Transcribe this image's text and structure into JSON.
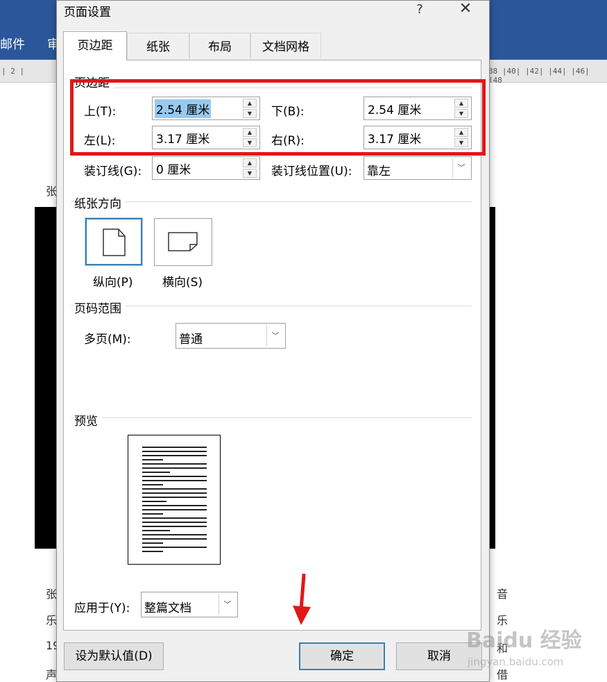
{
  "background": {
    "ribbon_tabs": [
      "邮件",
      "审"
    ],
    "ruler_left": "| 2 | ",
    "ruler_right": "38  |40|  |42|  |44|  |46|  |48",
    "doc_chars_left": [
      "张",
      "张",
      "乐",
      "19",
      "声"
    ],
    "doc_chars_right": [
      "音",
      "乐",
      "和",
      "借"
    ],
    "colors": {
      "ribbon": "#2b579a",
      "doc_image": "#000000"
    }
  },
  "dialog": {
    "title": "页面设置",
    "help_label": "?",
    "close_label": "✕",
    "tabs": [
      {
        "label": "页边距",
        "active": true
      },
      {
        "label": "纸张",
        "active": false
      },
      {
        "label": "布局",
        "active": false
      },
      {
        "label": "文档网格",
        "active": false
      }
    ],
    "margins": {
      "section_label": "页边距",
      "top": {
        "label": "上(T):",
        "value": "2.54 厘米"
      },
      "bottom": {
        "label": "下(B):",
        "value": "2.54 厘米"
      },
      "left": {
        "label": "左(L):",
        "value": "3.17 厘米"
      },
      "right": {
        "label": "右(R):",
        "value": "3.17 厘米"
      },
      "gutter": {
        "label": "装订线(G):",
        "value": "0 厘米"
      },
      "gutter_pos": {
        "label": "装订线位置(U):",
        "value": "靠左"
      }
    },
    "orientation": {
      "section_label": "纸张方向",
      "portrait": {
        "label": "纵向(P)",
        "selected": true
      },
      "landscape": {
        "label": "横向(S)",
        "selected": false
      }
    },
    "pages": {
      "section_label": "页码范围",
      "multiple_label": "多页(M):",
      "multiple_value": "普通"
    },
    "preview": {
      "section_label": "预览"
    },
    "apply_to": {
      "label": "应用于(Y):",
      "value": "整篇文档"
    },
    "buttons": {
      "set_default": "设为默认值(D)",
      "ok": "确定",
      "cancel": "取消"
    }
  },
  "annotations": {
    "highlight_color": "#e01818",
    "arrow_color": "#e01818"
  },
  "watermark": {
    "brand": "Baidu 经验",
    "url": "jingyan.baidu.com"
  }
}
